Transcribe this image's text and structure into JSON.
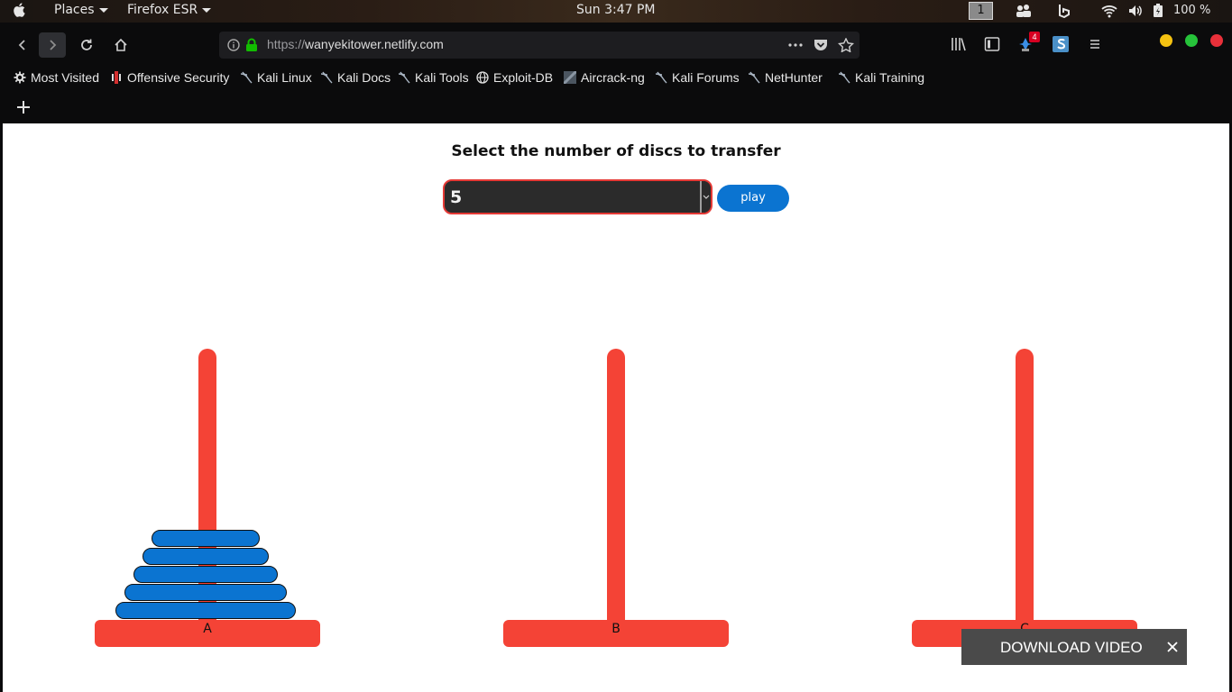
{
  "system_bar": {
    "places_label": "Places",
    "app_label": "Firefox ESR",
    "clock": "Sun 3:47 PM",
    "workspace": "1",
    "battery": "100 %"
  },
  "browser": {
    "url_protocol": "https://",
    "url_host": "wanyekitower.netlify.com",
    "extension_badge": "4",
    "bookmarks": [
      {
        "label": "Most Visited",
        "icon": "gear-icon"
      },
      {
        "label": "Offensive Security",
        "icon": "offsec-icon"
      },
      {
        "label": "Kali Linux",
        "icon": "kali-dragon-icon"
      },
      {
        "label": "Kali Docs",
        "icon": "kali-dragon-icon"
      },
      {
        "label": "Kali Tools",
        "icon": "kali-dragon-icon"
      },
      {
        "label": "Exploit-DB",
        "icon": "globe-icon"
      },
      {
        "label": "Aircrack-ng",
        "icon": "aircrack-icon"
      },
      {
        "label": "Kali Forums",
        "icon": "kali-dragon-icon"
      },
      {
        "label": "NetHunter",
        "icon": "kali-dragon-icon"
      },
      {
        "label": "Kali Training",
        "icon": "kali-dragon-icon"
      }
    ]
  },
  "page": {
    "title": "Select the number of discs to transfer",
    "disc_select_value": "5",
    "play_label": "play",
    "towers": [
      {
        "label": "A",
        "disc_count": 5
      },
      {
        "label": "B",
        "disc_count": 0
      },
      {
        "label": "C",
        "disc_count": 0
      }
    ],
    "download_bar_label": "DOWNLOAD VIDEO"
  },
  "colors": {
    "tower": "#f44336",
    "disc": "#0b74d1",
    "play_button": "#0b74d1"
  }
}
